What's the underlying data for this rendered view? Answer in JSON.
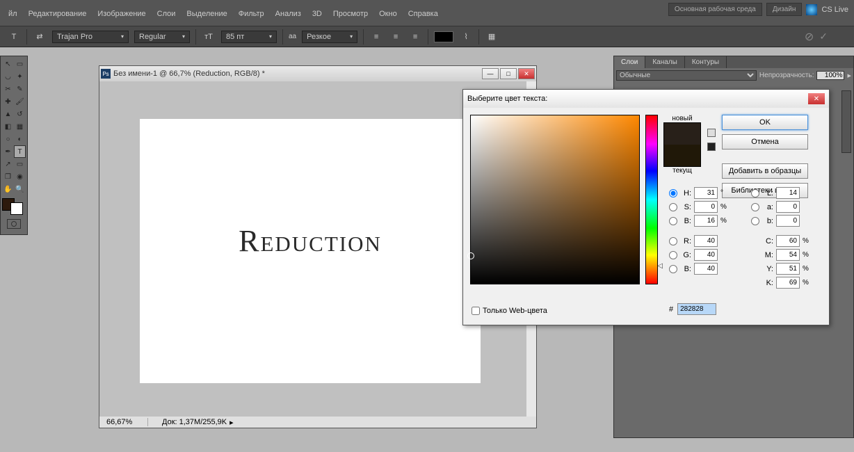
{
  "menu": {
    "items": [
      "йл",
      "Редактирование",
      "Изображение",
      "Слои",
      "Выделение",
      "Фильтр",
      "Анализ",
      "3D",
      "Просмотр",
      "Окно",
      "Справка"
    ]
  },
  "topright": {
    "env1": "Основная рабочая среда",
    "env2": "Дизайн",
    "live": "CS Live"
  },
  "optbar": {
    "font": "Trajan Pro",
    "style": "Regular",
    "size": "85 пт",
    "aa": "Резкое"
  },
  "doc": {
    "title": "Без имени-1 @ 66,7% (Reduction, RGB/8) *",
    "content": "Reduction",
    "zoom": "66,67%",
    "status": "Док: 1,37M/255,9K"
  },
  "layers": {
    "tabs": [
      "Слои",
      "Каналы",
      "Контуры"
    ],
    "mode": "Обычные",
    "opacity_label": "Непрозрачность:",
    "opacity": "100%"
  },
  "cp": {
    "title": "Выберите цвет текста:",
    "new": "новый",
    "current": "текущ",
    "ok": "OK",
    "cancel": "Отмена",
    "add": "Добавить в образцы",
    "libs": "Библиотеки цветов",
    "H": "31",
    "S": "0",
    "Bv": "16",
    "R": "40",
    "G": "40",
    "B": "40",
    "L": "14",
    "a": "0",
    "b": "0",
    "C": "60",
    "M": "54",
    "Y": "51",
    "K": "69",
    "hex": "282828",
    "webonly": "Только Web-цвета"
  }
}
